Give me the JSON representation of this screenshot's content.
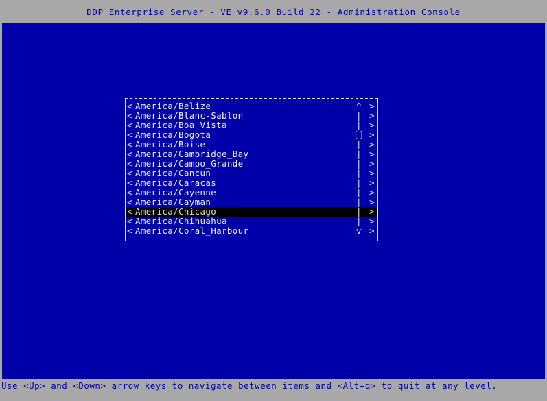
{
  "titlebar": {
    "text": "DDP Enterprise Server - VE v9.6.0 Build 22 - Administration Console"
  },
  "statusbar": {
    "text": "Use <Up> and <Down> arrow keys to navigate between items and <Alt+q> to quit at any level."
  },
  "dialog": {
    "left_marker": "<",
    "right_marker": ">",
    "scroll_up_glyph": "^",
    "scroll_down_glyph": "v",
    "scroll_track_glyph": "|",
    "scroll_thumb_glyph": "[]",
    "selected_index": 11,
    "items": [
      {
        "label": "America/Belize",
        "scroll": "^",
        "selected": false
      },
      {
        "label": "America/Blanc-Sablon",
        "scroll": "|",
        "selected": false
      },
      {
        "label": "America/Boa_Vista",
        "scroll": "|",
        "selected": false
      },
      {
        "label": "America/Bogota",
        "scroll": "[]",
        "selected": false
      },
      {
        "label": "America/Boise",
        "scroll": "|",
        "selected": false
      },
      {
        "label": "America/Cambridge_Bay",
        "scroll": "|",
        "selected": false
      },
      {
        "label": "America/Campo_Grande",
        "scroll": "|",
        "selected": false
      },
      {
        "label": "America/Cancun",
        "scroll": "|",
        "selected": false
      },
      {
        "label": "America/Caracas",
        "scroll": "|",
        "selected": false
      },
      {
        "label": "America/Cayenne",
        "scroll": "|",
        "selected": false
      },
      {
        "label": "America/Cayman",
        "scroll": "|",
        "selected": false
      },
      {
        "label": "America/Chicago",
        "scroll": "|",
        "selected": true
      },
      {
        "label": "America/Chihuahua",
        "scroll": "|",
        "selected": false
      },
      {
        "label": "America/Coral_Harbour",
        "scroll": "v",
        "selected": false
      }
    ]
  },
  "colors": {
    "desktop_background": "#0000a8",
    "bar_background": "#a8a8a8",
    "bar_text": "#0000a8",
    "list_text": "#f0f0f0",
    "selection_background": "#000000",
    "border": "#e8e8e8"
  }
}
